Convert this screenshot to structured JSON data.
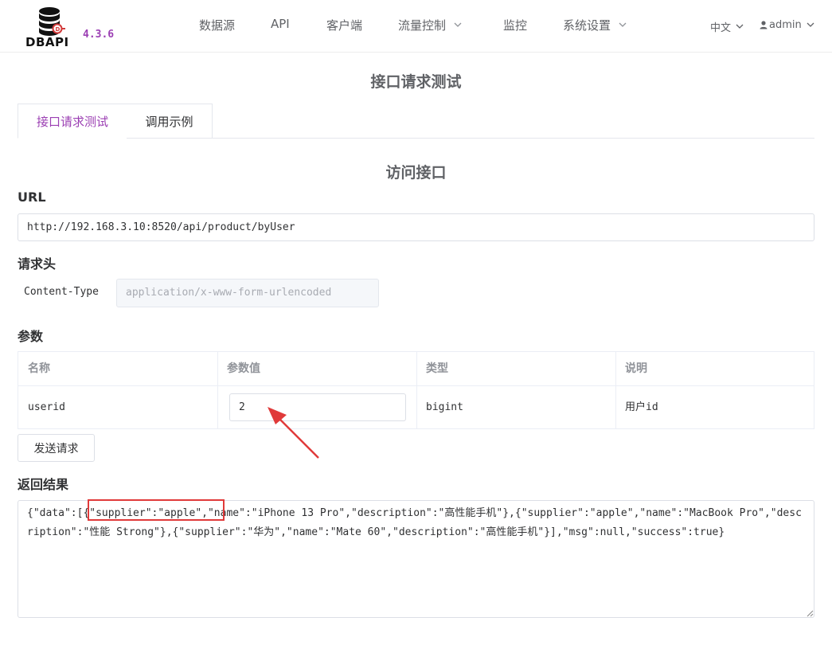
{
  "app": {
    "logo_text": "DBAPI",
    "version": "4.3.6"
  },
  "nav": {
    "items": [
      {
        "label": "数据源",
        "dropdown": false
      },
      {
        "label": "API",
        "dropdown": false
      },
      {
        "label": "客户端",
        "dropdown": false
      },
      {
        "label": "流量控制",
        "dropdown": true
      },
      {
        "label": "监控",
        "dropdown": false
      },
      {
        "label": "系统设置",
        "dropdown": true
      }
    ],
    "language": "中文",
    "user": "admin"
  },
  "page": {
    "title": "接口请求测试",
    "tabs": [
      "接口请求测试",
      "调用示例"
    ],
    "active_tab": 0,
    "section_title": "访问接口"
  },
  "request": {
    "url_label": "URL",
    "url": "http://192.168.3.10:8520/api/product/byUser",
    "headers_label": "请求头",
    "header_key": "Content-Type",
    "header_placeholder": "application/x-www-form-urlencoded"
  },
  "params": {
    "label": "参数",
    "columns": [
      "名称",
      "参数值",
      "类型",
      "说明"
    ],
    "rows": [
      {
        "name": "userid",
        "value": "2",
        "type": "bigint",
        "desc": "用户id"
      }
    ]
  },
  "actions": {
    "send_label": "发送请求"
  },
  "response": {
    "label": "返回结果",
    "body": "{\"data\":[{\"supplier\":\"apple\",\"name\":\"iPhone 13 Pro\",\"description\":\"高性能手机\"},{\"supplier\":\"apple\",\"name\":\"MacBook Pro\",\"description\":\"性能 Strong\"},{\"supplier\":\"华为\",\"name\":\"Mate 60\",\"description\":\"高性能手机\"}],\"msg\":null,\"success\":true}"
  },
  "colors": {
    "accent": "#9b3fb3",
    "annotation": "#e03a3a"
  }
}
